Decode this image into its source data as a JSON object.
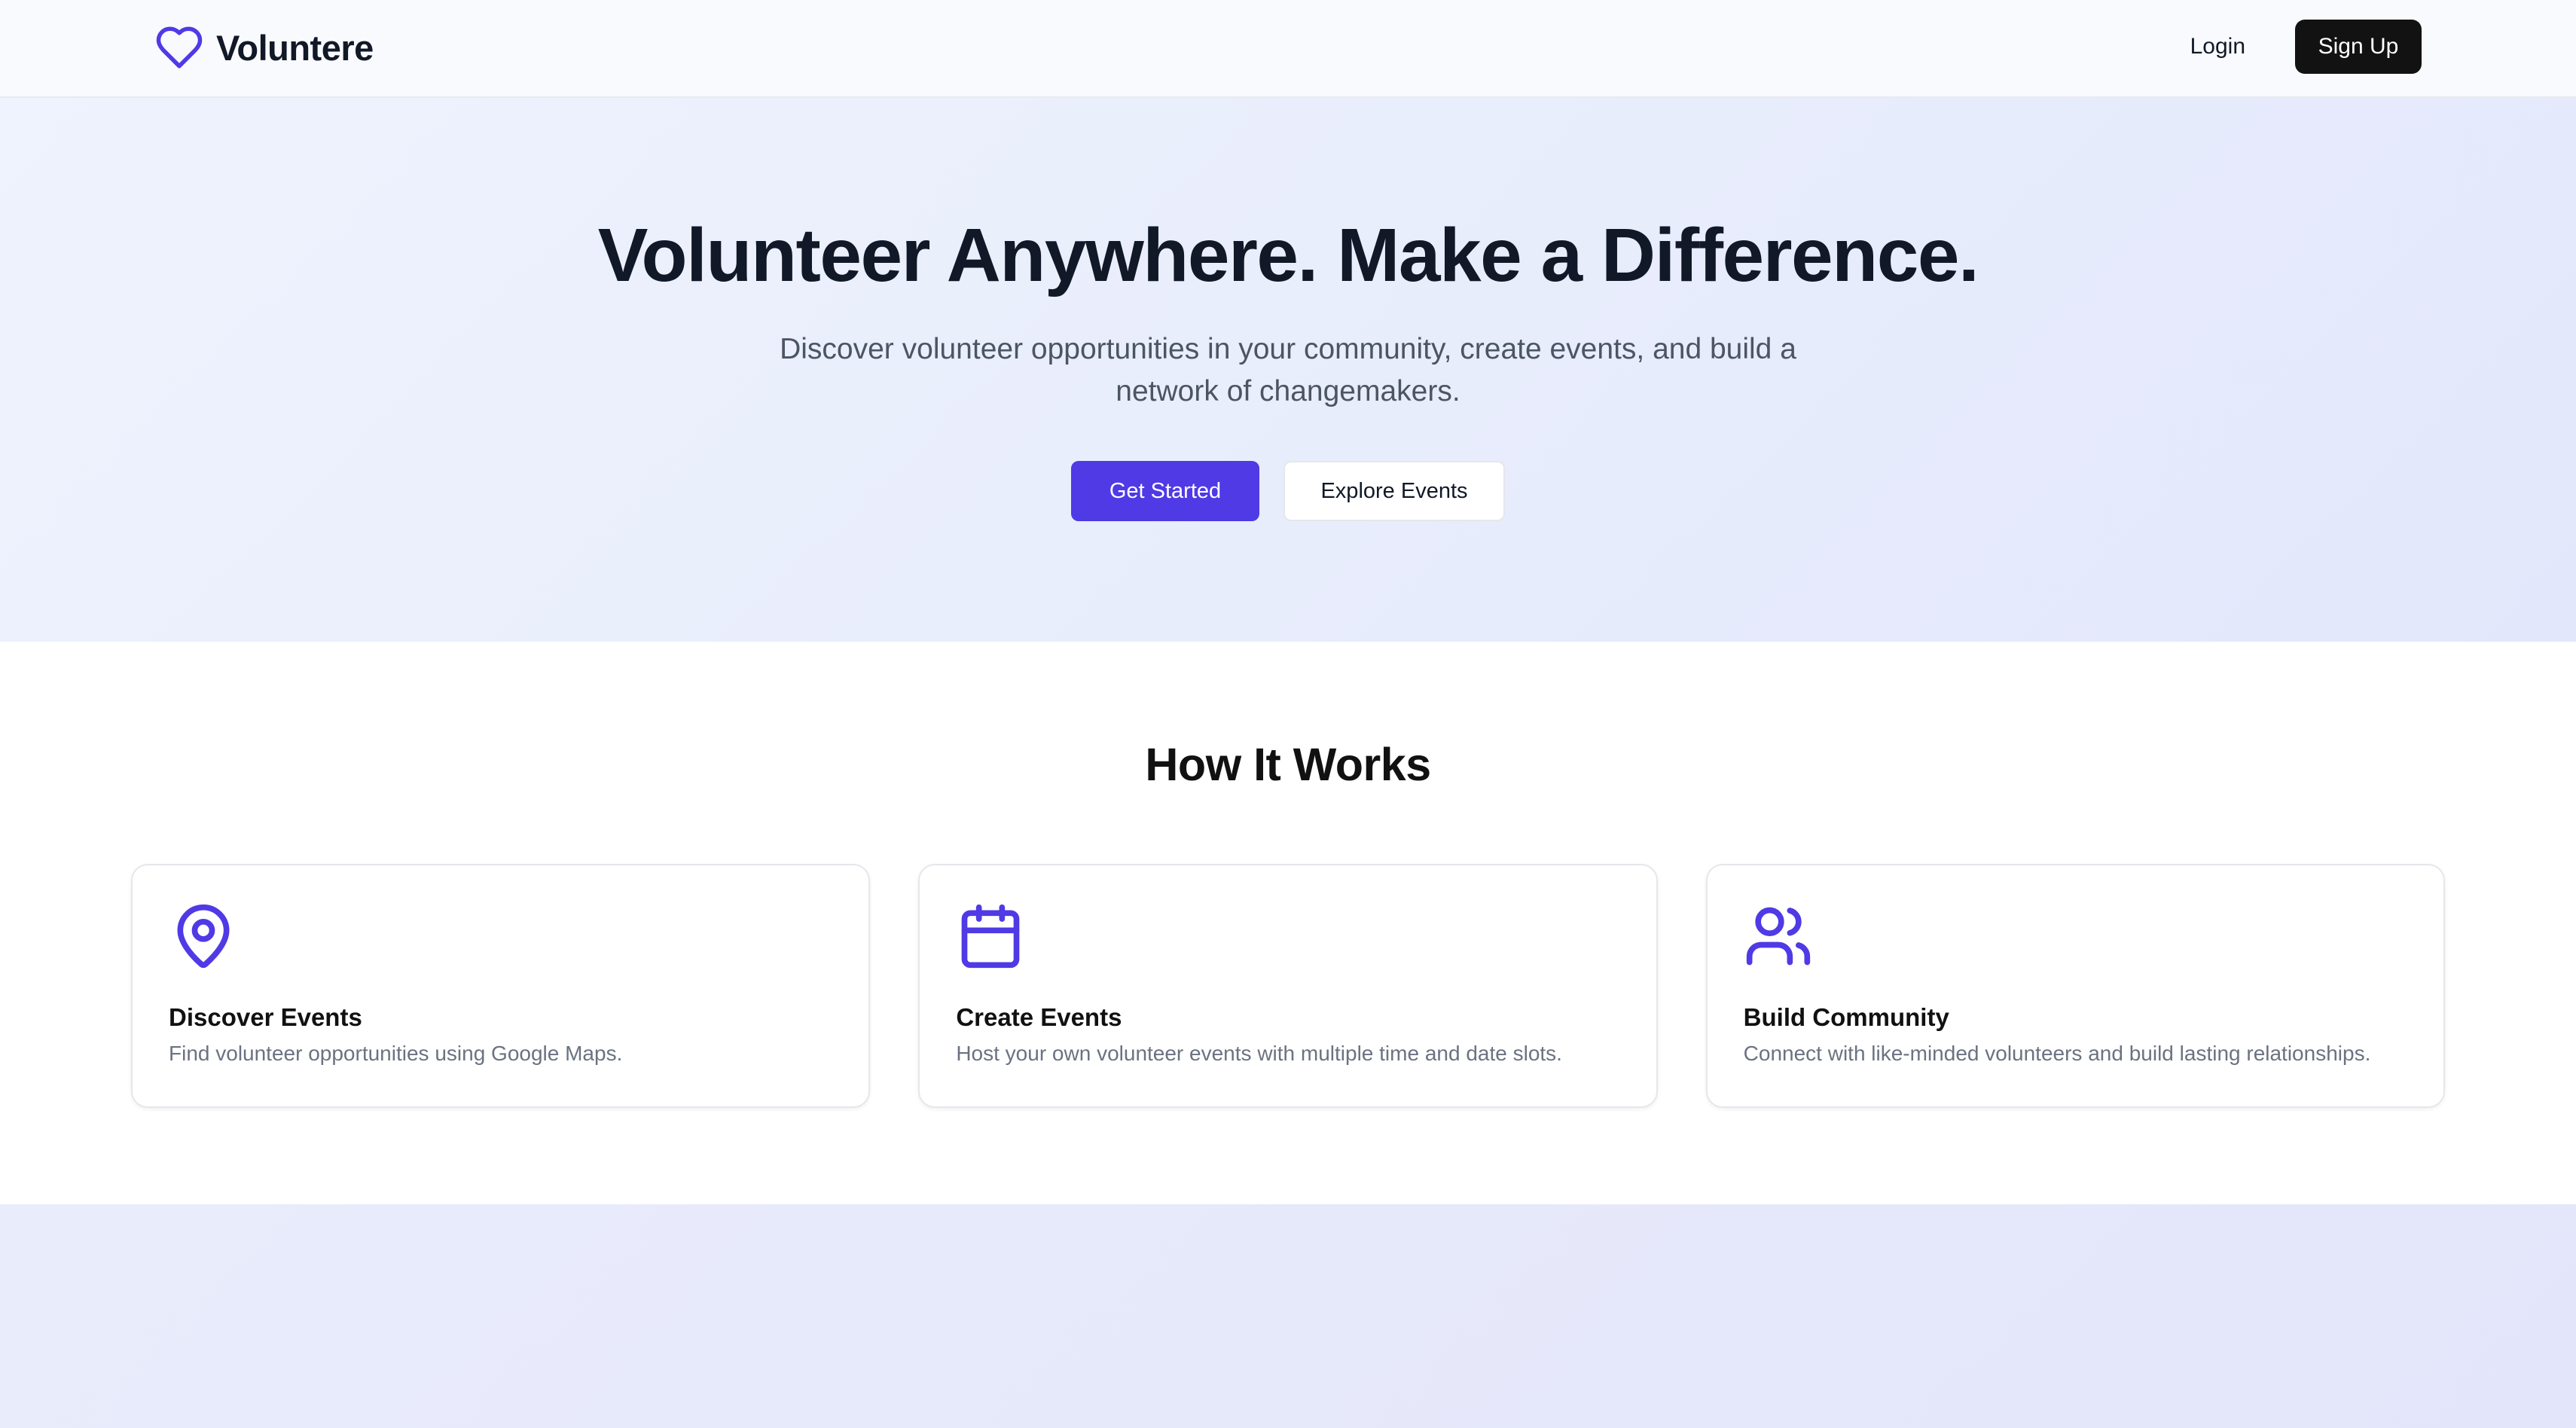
{
  "colors": {
    "brand": "#4f3ae5",
    "dark": "#121212",
    "hero_bg": "#e8edfc"
  },
  "header": {
    "brand_name": "Voluntere",
    "brand_icon": "heart-icon",
    "login_label": "Login",
    "signup_label": "Sign Up"
  },
  "hero": {
    "title": "Volunteer Anywhere. Make a Difference.",
    "subtitle": "Discover volunteer opportunities in your community, create events, and build a network of changemakers.",
    "primary_cta": "Get Started",
    "secondary_cta": "Explore Events"
  },
  "how_it_works": {
    "title": "How It Works",
    "cards": [
      {
        "icon": "map-pin-icon",
        "title": "Discover Events",
        "description": "Find volunteer opportunities using Google Maps."
      },
      {
        "icon": "calendar-icon",
        "title": "Create Events",
        "description": "Host your own volunteer events with multiple time and date slots."
      },
      {
        "icon": "users-icon",
        "title": "Build Community",
        "description": "Connect with like-minded volunteers and build lasting relationships."
      }
    ]
  }
}
